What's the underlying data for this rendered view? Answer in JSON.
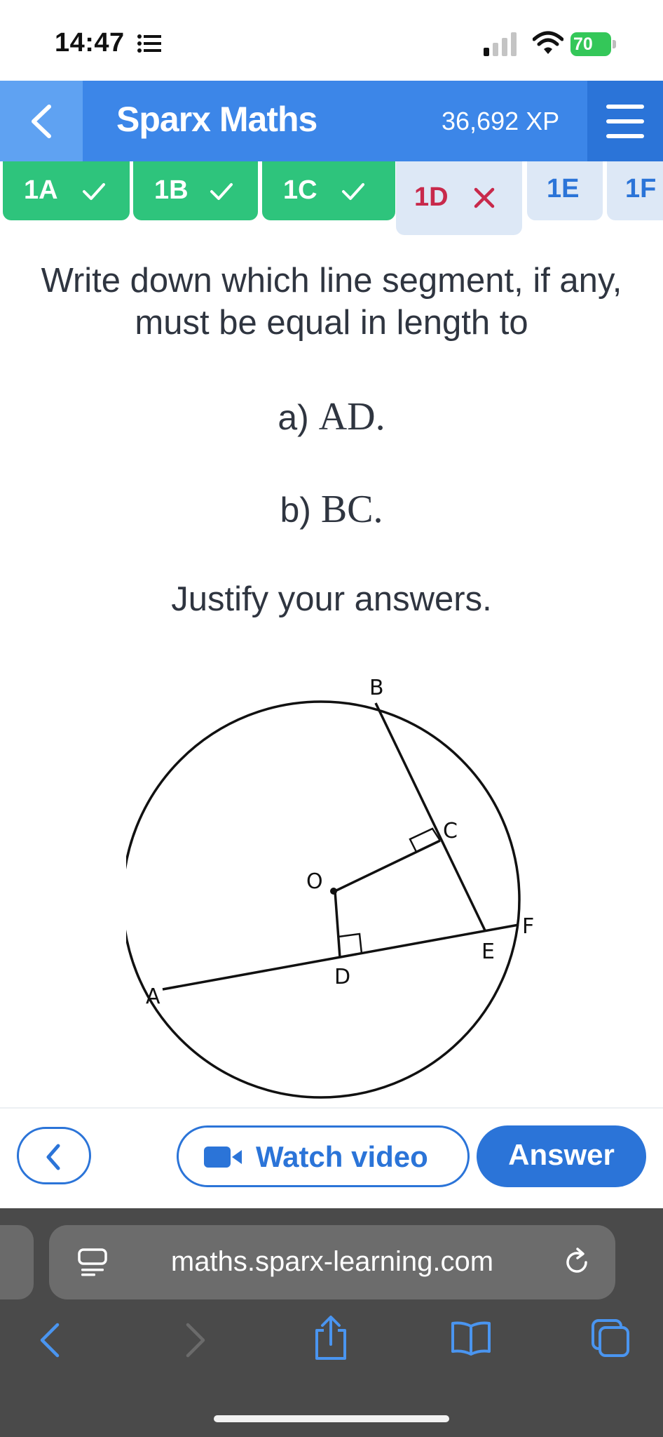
{
  "status_bar": {
    "time": "14:47",
    "battery_level": "70"
  },
  "header": {
    "title": "Sparx Maths",
    "xp": "36,692 XP"
  },
  "tabs": [
    {
      "label": "1A",
      "state": "correct"
    },
    {
      "label": "1B",
      "state": "correct"
    },
    {
      "label": "1C",
      "state": "correct"
    },
    {
      "label": "1D",
      "state": "incorrect"
    },
    {
      "label": "1E",
      "state": "unanswered"
    },
    {
      "label": "1F",
      "state": "unanswered"
    }
  ],
  "question": {
    "line1": "Write down which line segment, if any,",
    "line2": "must be equal in length to",
    "part_a_prefix": "a)",
    "part_a_math": "AD.",
    "part_b_prefix": "b)",
    "part_b_math": "BC.",
    "justify": "Justify your answers."
  },
  "diagram": {
    "labels": {
      "A": "A",
      "B": "B",
      "C": "C",
      "D": "D",
      "E": "E",
      "F": "F",
      "O": "O"
    }
  },
  "actions": {
    "watch_video": "Watch video",
    "answer": "Answer"
  },
  "browser": {
    "url": "maths.sparx-learning.com"
  },
  "colors": {
    "brand_blue": "#3c86e8",
    "correct_green": "#2ec47c",
    "incorrect_red": "#c8294b",
    "button_blue": "#2b74d8"
  }
}
